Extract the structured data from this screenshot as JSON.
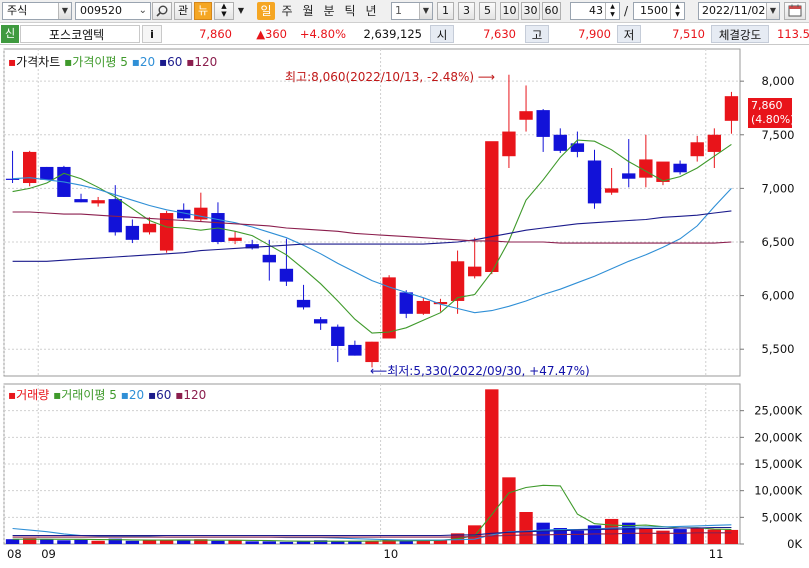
{
  "toolbar": {
    "market": "주식",
    "code": "009520",
    "btn_interest": "관",
    "btn_news": "뉴",
    "periods": [
      "일",
      "주",
      "월",
      "분",
      "틱",
      "년"
    ],
    "interval_value": "1",
    "quick_intervals": [
      "1",
      "3",
      "5",
      "10",
      "30",
      "60"
    ],
    "visible_count": "43",
    "separator": "/",
    "total_count": "1500",
    "date": "2022/11/02"
  },
  "quote": {
    "badge": "신",
    "name": "포스코엠텍",
    "info_button": "i",
    "price": "7,860",
    "change": "▲360",
    "change_pct": "+4.80%",
    "volume": "2,639,125",
    "open_label": "시",
    "open": "7,630",
    "high_label": "고",
    "high": "7,900",
    "low_label": "저",
    "low": "7,510",
    "strength_label": "체결강도",
    "strength": "113.5"
  },
  "price_legend": {
    "marker": "▪",
    "title": "가격차트",
    "ma_label": "가격이평",
    "ma_periods": [
      "5",
      "20",
      "60",
      "120"
    ]
  },
  "volume_legend": {
    "marker": "▪",
    "title": "거래량",
    "ma_label": "거래이평",
    "ma_periods": [
      "5",
      "20",
      "60",
      "120"
    ]
  },
  "annotations": {
    "high_note": "최고:8,060(2022/10/13, -2.48%)",
    "low_note": "최저:5,330(2022/09/30, +47.47%)",
    "current_price": "7,860",
    "current_pct": "(4.80%)"
  },
  "colors": {
    "up": "#e8141a",
    "down": "#1212d8",
    "ma5": "#3f9a2b",
    "ma20": "#2f8fd6",
    "ma60": "#1b1b8c",
    "ma120": "#8b1e4d",
    "grid": "#d0d0d0"
  },
  "chart_data": [
    {
      "type": "candlestick",
      "title": "가격차트",
      "ylim": [
        5250,
        8300
      ],
      "y_ticks": [
        "8,000",
        "7,500",
        "7,000",
        "6,500",
        "6,000",
        "5,500"
      ],
      "y_tick_values": [
        8000,
        7500,
        7000,
        6500,
        6000,
        5500
      ],
      "x_tick_labels": [
        "08",
        "09",
        "10",
        "11"
      ],
      "x_tick_index": [
        0,
        2,
        22,
        41
      ],
      "grid": true,
      "series_names": [
        "5",
        "20",
        "60",
        "120"
      ],
      "candles": [
        {
          "o": 7090,
          "h": 7350,
          "l": 7050,
          "c": 7080
        },
        {
          "o": 7050,
          "h": 7350,
          "l": 7020,
          "c": 7340
        },
        {
          "o": 7200,
          "h": 7200,
          "l": 7080,
          "c": 7080
        },
        {
          "o": 7200,
          "h": 7210,
          "l": 6920,
          "c": 6920
        },
        {
          "o": 6900,
          "h": 6950,
          "l": 6870,
          "c": 6870
        },
        {
          "o": 6860,
          "h": 6920,
          "l": 6830,
          "c": 6890
        },
        {
          "o": 6900,
          "h": 7030,
          "l": 6560,
          "c": 6590
        },
        {
          "o": 6650,
          "h": 6710,
          "l": 6490,
          "c": 6520
        },
        {
          "o": 6590,
          "h": 6730,
          "l": 6570,
          "c": 6670
        },
        {
          "o": 6420,
          "h": 6790,
          "l": 6400,
          "c": 6770
        },
        {
          "o": 6800,
          "h": 6860,
          "l": 6700,
          "c": 6720
        },
        {
          "o": 6710,
          "h": 6960,
          "l": 6690,
          "c": 6820
        },
        {
          "o": 6770,
          "h": 6870,
          "l": 6480,
          "c": 6500
        },
        {
          "o": 6510,
          "h": 6600,
          "l": 6480,
          "c": 6540
        },
        {
          "o": 6480,
          "h": 6520,
          "l": 6430,
          "c": 6440
        },
        {
          "o": 6380,
          "h": 6520,
          "l": 6140,
          "c": 6310
        },
        {
          "o": 6250,
          "h": 6530,
          "l": 6090,
          "c": 6130
        },
        {
          "o": 5960,
          "h": 6100,
          "l": 5870,
          "c": 5890
        },
        {
          "o": 5780,
          "h": 5800,
          "l": 5680,
          "c": 5740
        },
        {
          "o": 5710,
          "h": 5730,
          "l": 5380,
          "c": 5530
        },
        {
          "o": 5540,
          "h": 5580,
          "l": 5440,
          "c": 5440
        },
        {
          "o": 5380,
          "h": 5570,
          "l": 5330,
          "c": 5570
        },
        {
          "o": 5600,
          "h": 6190,
          "l": 5600,
          "c": 6170
        },
        {
          "o": 6030,
          "h": 6050,
          "l": 5790,
          "c": 5830
        },
        {
          "o": 5830,
          "h": 5980,
          "l": 5820,
          "c": 5950
        },
        {
          "o": 5920,
          "h": 5970,
          "l": 5850,
          "c": 5940
        },
        {
          "o": 5950,
          "h": 6420,
          "l": 5830,
          "c": 6320
        },
        {
          "o": 6180,
          "h": 6540,
          "l": 6160,
          "c": 6270
        },
        {
          "o": 6220,
          "h": 7340,
          "l": 6200,
          "c": 7440
        },
        {
          "o": 7300,
          "h": 8060,
          "l": 7190,
          "c": 7530
        },
        {
          "o": 7640,
          "h": 7960,
          "l": 7530,
          "c": 7720
        },
        {
          "o": 7730,
          "h": 7740,
          "l": 7340,
          "c": 7480
        },
        {
          "o": 7500,
          "h": 7560,
          "l": 7330,
          "c": 7350
        },
        {
          "o": 7420,
          "h": 7530,
          "l": 7290,
          "c": 7340
        },
        {
          "o": 7260,
          "h": 7360,
          "l": 6810,
          "c": 6860
        },
        {
          "o": 6960,
          "h": 7190,
          "l": 6940,
          "c": 7000
        },
        {
          "o": 7140,
          "h": 7460,
          "l": 7010,
          "c": 7090
        },
        {
          "o": 7100,
          "h": 7500,
          "l": 7010,
          "c": 7270
        },
        {
          "o": 7060,
          "h": 7240,
          "l": 7030,
          "c": 7250
        },
        {
          "o": 7230,
          "h": 7260,
          "l": 7130,
          "c": 7150
        },
        {
          "o": 7300,
          "h": 7490,
          "l": 7250,
          "c": 7430
        },
        {
          "o": 7340,
          "h": 7560,
          "l": 7190,
          "c": 7500
        },
        {
          "o": 7630,
          "h": 7900,
          "l": 7510,
          "c": 7860
        }
      ],
      "ma": {
        "5": [
          6970,
          7000,
          7050,
          7140,
          7090,
          7010,
          6920,
          6810,
          6700,
          6640,
          6630,
          6610,
          6630,
          6600,
          6560,
          6470,
          6380,
          6250,
          6110,
          5950,
          5780,
          5650,
          5660,
          5700,
          5770,
          5840,
          5980,
          6010,
          6220,
          6510,
          6890,
          7080,
          7290,
          7450,
          7440,
          7360,
          7250,
          7160,
          7070,
          7110,
          7190,
          7300,
          7410
        ],
        "20": [
          7090,
          7100,
          7080,
          7060,
          7030,
          6990,
          6940,
          6890,
          6840,
          6800,
          6770,
          6740,
          6710,
          6680,
          6640,
          6590,
          6540,
          6470,
          6390,
          6300,
          6220,
          6140,
          6080,
          6030,
          5980,
          5920,
          5880,
          5840,
          5860,
          5900,
          5950,
          6010,
          6060,
          6120,
          6180,
          6250,
          6320,
          6380,
          6450,
          6530,
          6650,
          6830,
          7000
        ],
        "60": [
          6320,
          6320,
          6320,
          6330,
          6340,
          6350,
          6360,
          6370,
          6380,
          6390,
          6400,
          6420,
          6430,
          6440,
          6450,
          6460,
          6470,
          6480,
          6480,
          6480,
          6480,
          6480,
          6480,
          6480,
          6480,
          6490,
          6500,
          6520,
          6550,
          6580,
          6610,
          6630,
          6650,
          6670,
          6680,
          6690,
          6700,
          6710,
          6730,
          6740,
          6750,
          6770,
          6790
        ],
        "120": [
          6780,
          6780,
          6770,
          6760,
          6760,
          6750,
          6740,
          6730,
          6720,
          6710,
          6700,
          6690,
          6680,
          6670,
          6660,
          6650,
          6630,
          6620,
          6610,
          6600,
          6580,
          6570,
          6560,
          6550,
          6540,
          6530,
          6520,
          6510,
          6510,
          6500,
          6500,
          6500,
          6490,
          6490,
          6490,
          6490,
          6490,
          6490,
          6490,
          6490,
          6490,
          6490,
          6500
        ]
      }
    },
    {
      "type": "bar",
      "title": "거래량",
      "ylim": [
        0,
        30000
      ],
      "unit": "K",
      "y_ticks": [
        "25,000K",
        "20,000K",
        "15,000K",
        "10,000K",
        "5,000K",
        "0K"
      ],
      "y_tick_values": [
        25000,
        20000,
        15000,
        10000,
        5000,
        0
      ],
      "series_names": [
        "5",
        "20",
        "60",
        "120"
      ],
      "values": [
        900,
        1100,
        900,
        700,
        800,
        600,
        1000,
        600,
        700,
        800,
        700,
        900,
        600,
        700,
        500,
        500,
        400,
        500,
        700,
        500,
        500,
        600,
        800,
        700,
        600,
        700,
        2000,
        3500,
        29000,
        12500,
        6000,
        4000,
        3000,
        2500,
        3500,
        4700,
        4000,
        3000,
        2500,
        2800,
        3000,
        2700,
        2639
      ],
      "ma": {
        "5": [
          900,
          900,
          900,
          880,
          880,
          820,
          800,
          760,
          740,
          740,
          760,
          740,
          720,
          710,
          680,
          640,
          560,
          520,
          520,
          520,
          520,
          540,
          600,
          600,
          640,
          680,
          1000,
          1560,
          5520,
          9600,
          10600,
          11000,
          10900,
          5600,
          3800,
          3540,
          3440,
          3540,
          3240,
          3000,
          3060,
          2800,
          2730
        ],
        "20": [
          2900,
          2600,
          2300,
          1900,
          1600,
          1500,
          1500,
          1500,
          1400,
          1300,
          1300,
          1300,
          1300,
          1300,
          1300,
          1300,
          1200,
          1200,
          1200,
          1100,
          1000,
          900,
          800,
          750,
          750,
          750,
          800,
          900,
          1700,
          2300,
          2400,
          2600,
          2700,
          2700,
          2800,
          3000,
          3100,
          3200,
          3200,
          3300,
          3400,
          3500,
          3600
        ],
        "60": [
          1600,
          1600,
          1600,
          1600,
          1600,
          1600,
          1600,
          1600,
          1600,
          1600,
          1600,
          1600,
          1600,
          1600,
          1600,
          1600,
          1600,
          1600,
          1600,
          1600,
          1600,
          1600,
          1600,
          1600,
          1600,
          1600,
          1700,
          1700,
          2000,
          2200,
          2300,
          2400,
          2500,
          2600,
          2700,
          2800,
          2800,
          2900,
          2900,
          3000,
          3000,
          3100,
          3100
        ],
        "120": [
          1300,
          1300,
          1300,
          1300,
          1300,
          1300,
          1300,
          1300,
          1300,
          1300,
          1300,
          1300,
          1300,
          1300,
          1300,
          1300,
          1300,
          1300,
          1300,
          1300,
          1300,
          1300,
          1300,
          1300,
          1300,
          1300,
          1300,
          1400,
          1500,
          1600,
          1700,
          1700,
          1800,
          1800,
          1900,
          1900,
          2000,
          2000,
          2000,
          2000,
          2100,
          2100,
          2100
        ]
      }
    }
  ]
}
